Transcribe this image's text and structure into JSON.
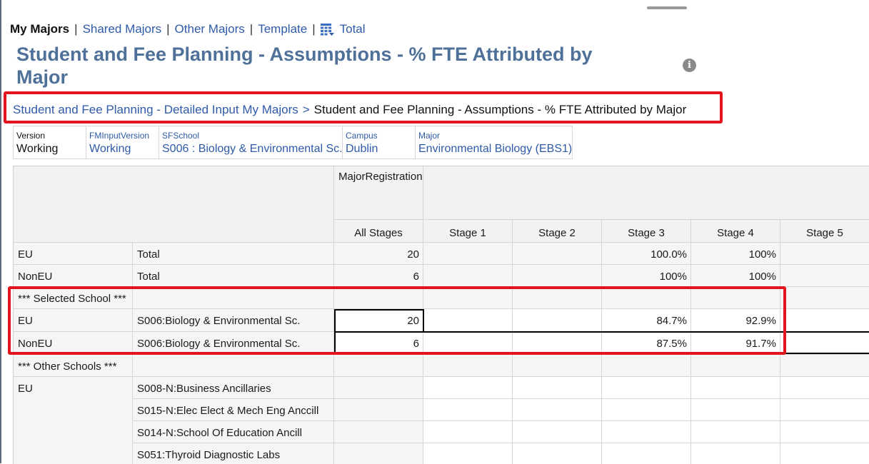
{
  "nav": {
    "current": "My Majors",
    "links": [
      "Shared Majors",
      "Other Majors",
      "Template"
    ],
    "total_label": "Total",
    "total_icon": "table-grid-icon",
    "separator": "|"
  },
  "page_title": "Student and Fee Planning - Assumptions - % FTE Attributed by Major",
  "info_icon": "info-icon",
  "breadcrumb": {
    "parent": "Student and Fee Planning - Detailed Input My Majors",
    "separator": ">",
    "current": "Student and Fee Planning - Assumptions - % FTE Attributed by Major"
  },
  "pov": [
    {
      "label": "Version",
      "value": "Working"
    },
    {
      "label": "FMInputVersion",
      "value": "Working"
    },
    {
      "label": "SFSchool",
      "value": "S006 : Biology & Environmental Sc."
    },
    {
      "label": "Campus",
      "value": "Dublin"
    },
    {
      "label": "Major",
      "value": "Environmental Biology (EBS1)"
    }
  ],
  "grid": {
    "column_group": "MajorRegistration",
    "columns": [
      "All Stages",
      "Stage 1",
      "Stage 2",
      "Stage 3",
      "Stage 4",
      "Stage 5"
    ],
    "rows": [
      {
        "r1": "EU",
        "r2": "Total",
        "values": [
          "20",
          "",
          "",
          "100.0%",
          "100%",
          ""
        ]
      },
      {
        "r1": "NonEU",
        "r2": "Total",
        "values": [
          "6",
          "",
          "",
          "100%",
          "100%",
          ""
        ]
      },
      {
        "r1": "*** Selected School ***",
        "r2": "",
        "values": [
          "",
          "",
          "",
          "",
          "",
          ""
        ]
      },
      {
        "r1": "EU",
        "r2": "S006:Biology & Environmental Sc.",
        "values": [
          "20",
          "",
          "",
          "84.7%",
          "92.9%",
          ""
        ]
      },
      {
        "r1": "NonEU",
        "r2": "S006:Biology & Environmental Sc.",
        "values": [
          "6",
          "",
          "",
          "87.5%",
          "91.7%",
          ""
        ]
      },
      {
        "r1": "*** Other Schools ***",
        "r2": "",
        "values": [
          "",
          "",
          "",
          "",
          "",
          ""
        ]
      },
      {
        "r1": "EU",
        "r2": "S008-N:Business Ancillaries",
        "values": [
          "",
          "",
          "",
          "",
          "",
          ""
        ]
      },
      {
        "r1": "",
        "r2": "S015-N:Elec Elect & Mech Eng Anccill",
        "values": [
          "",
          "",
          "",
          "",
          "",
          ""
        ]
      },
      {
        "r1": "",
        "r2": "S014-N:School Of Education Ancill",
        "values": [
          "",
          "",
          "",
          "",
          "",
          ""
        ]
      },
      {
        "r1": "",
        "r2": "S051:Thyroid Diagnostic Labs",
        "values": [
          "",
          "",
          "",
          "",
          "",
          ""
        ]
      }
    ]
  },
  "colors": {
    "title": "#4f7199",
    "link": "#2f5aa8",
    "highlight": "#e3141e"
  }
}
